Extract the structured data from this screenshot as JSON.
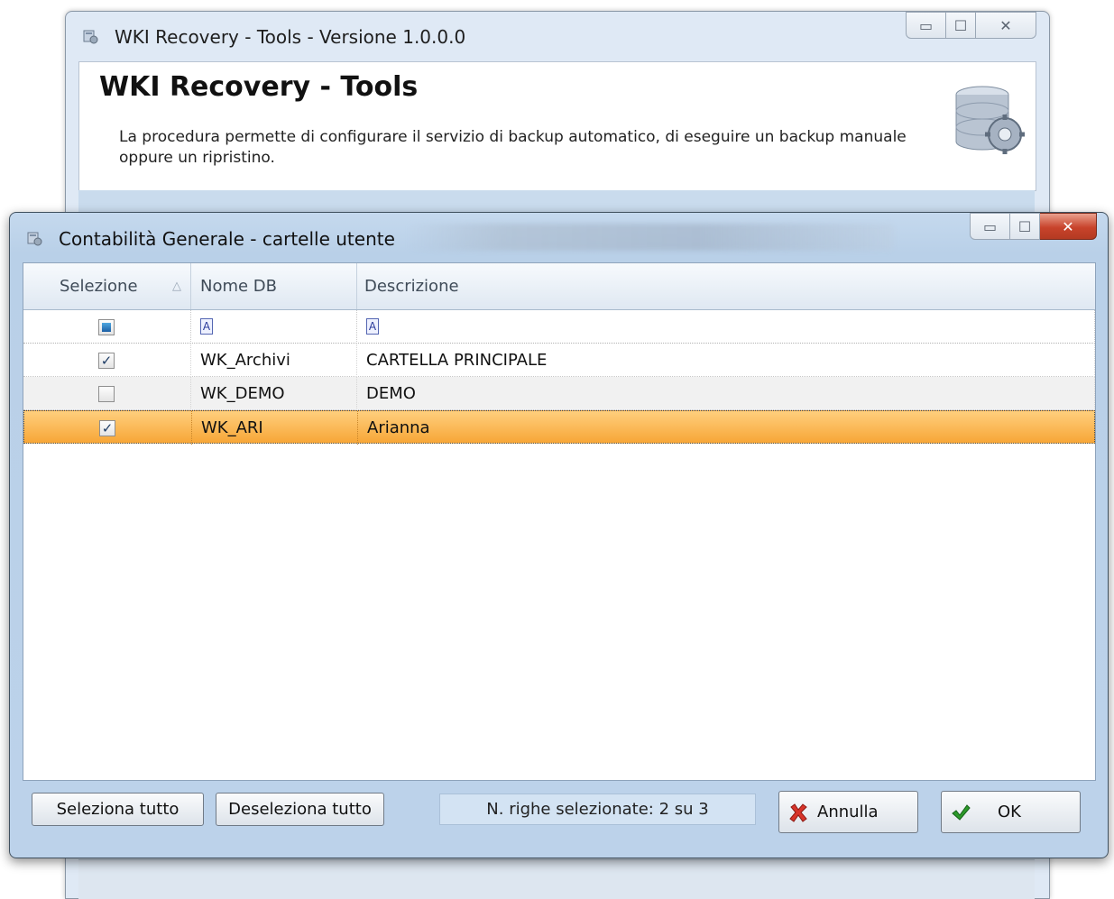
{
  "background_window": {
    "title": "WKI Recovery - Tools - Versione 1.0.0.0",
    "header_title": "WKI Recovery - Tools",
    "header_description": "La procedura permette di configurare il servizio di backup automatico, di eseguire un backup manuale oppure un ripristino."
  },
  "dialog": {
    "title": "Contabilità Generale - cartelle utente",
    "columns": [
      "Selezione",
      "Nome DB",
      "Descrizione"
    ],
    "filter_icon": "A",
    "rows": [
      {
        "checked": "✓",
        "nome_db": "WK_Archivi",
        "descrizione": "CARTELLA PRINCIPALE"
      },
      {
        "checked": "",
        "nome_db": "WK_DEMO",
        "descrizione": "DEMO"
      },
      {
        "checked": "✓",
        "nome_db": "WK_ARI",
        "descrizione": "Arianna"
      }
    ],
    "buttons": {
      "select_all": "Seleziona tutto",
      "deselect_all": "Deseleziona tutto",
      "cancel": "Annulla",
      "ok": "OK"
    },
    "status_text": "N. righe selezionate: 2 su 3"
  },
  "icons": {
    "window": "app-icon",
    "database": "database-gear-icon",
    "cancel": "red-x-icon",
    "ok": "green-check-icon",
    "sort": "sort-ascending-icon"
  },
  "colors": {
    "selected_row": "#f7a637",
    "dialog_frame": "#bcd2ea",
    "close_button": "#c8432b"
  }
}
